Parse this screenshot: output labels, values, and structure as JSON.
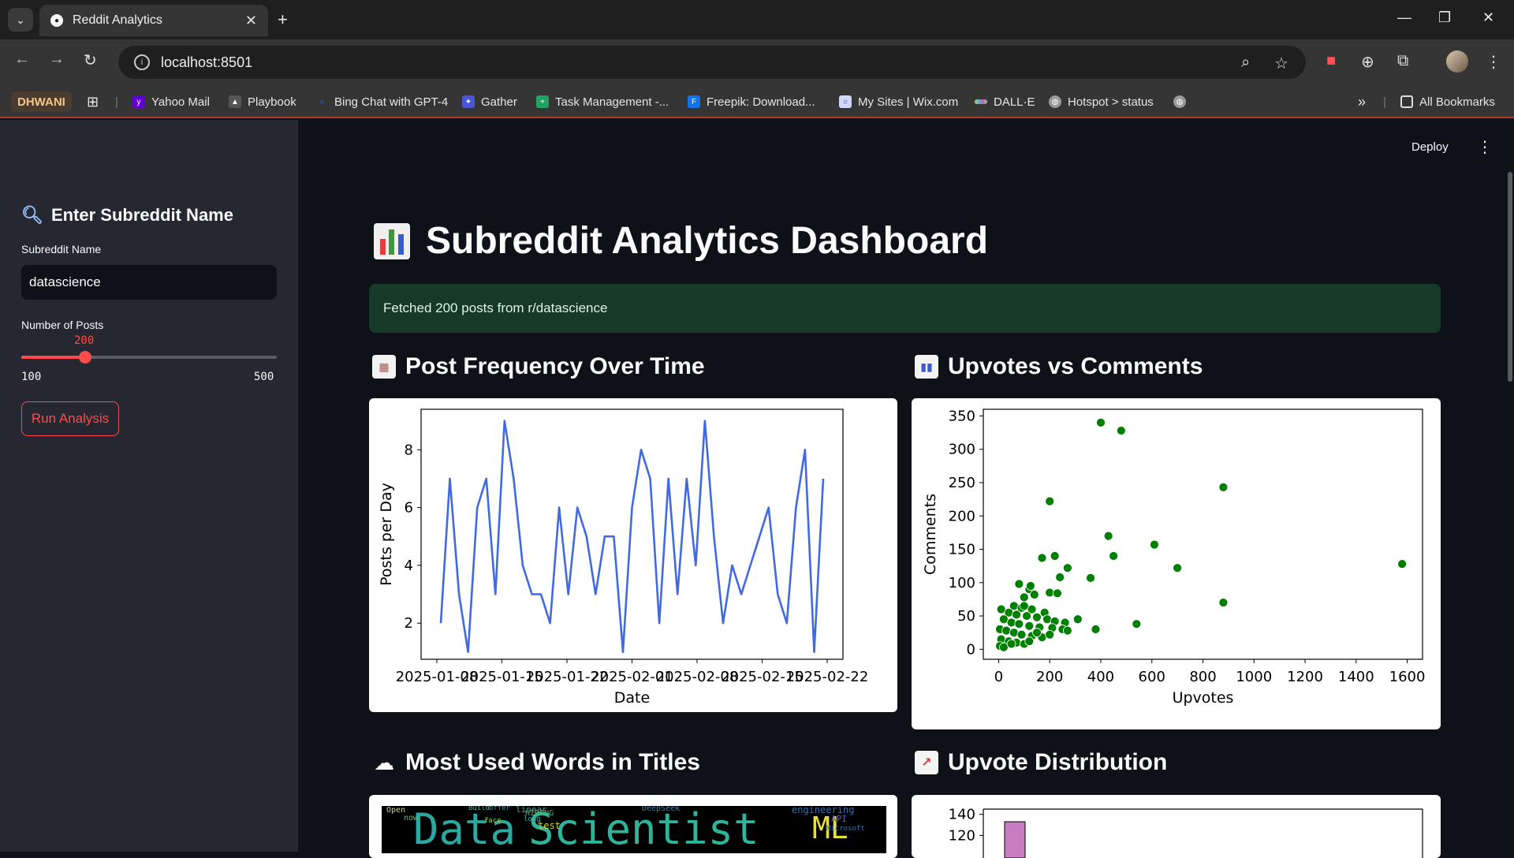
{
  "browser": {
    "tab_title": "Reddit Analytics",
    "url": "localhost:8501",
    "bookmarks": [
      {
        "label": "Yahoo Mail",
        "icon": "yahoo-icon",
        "color": "#6001d2"
      },
      {
        "label": "Playbook",
        "icon": "playbook-icon",
        "color": "#555555"
      },
      {
        "label": "Bing Chat with GPT-4",
        "icon": "bing-search-icon",
        "color": "#2b6de8"
      },
      {
        "label": "Gather",
        "icon": "gather-icon",
        "color": "#4b55d6"
      },
      {
        "label": "Task Management -...",
        "icon": "task-sheet-icon",
        "color": "#1ea362"
      },
      {
        "label": "Freepik: Download...",
        "icon": "freepik-icon",
        "color": "#1273eb"
      },
      {
        "label": "My Sites | Wix.com",
        "icon": "wix-icon",
        "color": "#d0d8ff"
      },
      {
        "label": "DALL·E",
        "icon": "dalle-icon",
        "color": "#e8c547"
      },
      {
        "label": "Hotspot > status",
        "icon": "globe-icon",
        "color": "#9a9a9a"
      }
    ],
    "profile_chip": "DHWANI",
    "all_bookmarks": "All Bookmarks"
  },
  "sidebar": {
    "header": "Enter Subreddit Name",
    "subreddit_label": "Subreddit Name",
    "subreddit_value": "datascience",
    "posts_label": "Number of Posts",
    "slider": {
      "value": 200,
      "min": 100,
      "max": 500,
      "value_text": "200",
      "min_text": "100",
      "max_text": "500"
    },
    "run_button": "Run Analysis"
  },
  "header": {
    "deploy": "Deploy"
  },
  "main": {
    "title": "Subreddit Analytics Dashboard",
    "success_message": "Fetched 200 posts from r/datascience",
    "sections": {
      "post_frequency": "Post Frequency Over Time",
      "upvotes_vs_comments": "Upvotes vs Comments",
      "word_cloud": "Most Used Words in Titles",
      "upvote_distribution": "Upvote Distribution"
    }
  },
  "colors": {
    "accent": "#ff4b4b",
    "line": "#4169e1",
    "scatter": "#008000",
    "hist": "#c77dbf"
  },
  "chart_data": [
    {
      "type": "line",
      "xlabel": "Date",
      "ylabel": "Posts per Day",
      "ylim": [
        0.75,
        9.4
      ],
      "yticks": [
        2,
        4,
        6,
        8
      ],
      "xticks": [
        "2025-01-08",
        "2025-01-15",
        "2025-01-22",
        "2025-02-01",
        "2025-02-08",
        "2025-02-15",
        "2025-02-22"
      ],
      "series": [
        {
          "values": [
            2,
            7,
            3,
            1,
            6,
            7,
            3,
            9,
            7,
            4,
            3,
            3,
            2,
            6,
            3,
            6,
            5,
            3,
            5,
            5,
            1,
            6,
            8,
            7,
            2,
            7,
            3,
            7,
            4,
            9,
            5,
            2,
            4,
            3,
            4,
            5,
            6,
            3,
            2,
            6,
            8,
            1,
            7
          ]
        }
      ]
    },
    {
      "type": "scatter",
      "xlabel": "Upvotes",
      "ylabel": "Comments",
      "xlim": [
        -60,
        1660
      ],
      "ylim": [
        -15,
        360
      ],
      "xticks": [
        0,
        200,
        400,
        600,
        800,
        1000,
        1200,
        1400,
        1600
      ],
      "yticks": [
        0,
        50,
        100,
        150,
        200,
        250,
        300,
        350
      ],
      "points": [
        [
          400,
          340
        ],
        [
          480,
          328
        ],
        [
          880,
          243
        ],
        [
          200,
          222
        ],
        [
          430,
          170
        ],
        [
          610,
          157
        ],
        [
          450,
          140
        ],
        [
          220,
          140
        ],
        [
          170,
          137
        ],
        [
          270,
          122
        ],
        [
          700,
          122
        ],
        [
          240,
          108
        ],
        [
          360,
          107
        ],
        [
          80,
          98
        ],
        [
          120,
          90
        ],
        [
          200,
          85
        ],
        [
          230,
          84
        ],
        [
          140,
          82
        ],
        [
          100,
          78
        ],
        [
          880,
          70
        ],
        [
          60,
          65
        ],
        [
          90,
          62
        ],
        [
          130,
          60
        ],
        [
          180,
          55
        ],
        [
          10,
          60
        ],
        [
          40,
          55
        ],
        [
          70,
          52
        ],
        [
          110,
          50
        ],
        [
          150,
          48
        ],
        [
          190,
          45
        ],
        [
          220,
          42
        ],
        [
          260,
          40
        ],
        [
          310,
          45
        ],
        [
          20,
          45
        ],
        [
          50,
          40
        ],
        [
          80,
          38
        ],
        [
          120,
          35
        ],
        [
          160,
          33
        ],
        [
          210,
          32
        ],
        [
          250,
          30
        ],
        [
          270,
          28
        ],
        [
          380,
          30
        ],
        [
          540,
          38
        ],
        [
          1580,
          128
        ],
        [
          5,
          30
        ],
        [
          30,
          28
        ],
        [
          60,
          25
        ],
        [
          90,
          22
        ],
        [
          130,
          20
        ],
        [
          170,
          18
        ],
        [
          10,
          15
        ],
        [
          40,
          12
        ],
        [
          70,
          10
        ],
        [
          100,
          8
        ],
        [
          5,
          5
        ],
        [
          20,
          3
        ],
        [
          50,
          8
        ],
        [
          120,
          12
        ],
        [
          150,
          25
        ],
        [
          200,
          22
        ],
        [
          100,
          65
        ],
        [
          125,
          95
        ]
      ]
    },
    {
      "type": "bar",
      "title": "",
      "ylim": [
        0,
        145
      ],
      "yticks": [
        120,
        140
      ],
      "values": [
        133
      ]
    }
  ],
  "word_cloud": {
    "words": [
      {
        "text": "Data",
        "color": "#2ba9a0",
        "size": 54
      },
      {
        "text": "Scientist",
        "color": "#2fb39a",
        "size": 54
      },
      {
        "text": "ML",
        "color": "#e6e03a",
        "size": 38
      },
      {
        "text": "test",
        "color": "#c9d23a",
        "size": 12
      },
      {
        "text": "HIRING",
        "color": "#5fae5a",
        "size": 10
      },
      {
        "text": "linear",
        "color": "#4e9a9a",
        "size": 11
      },
      {
        "text": "DeepSeek",
        "color": "#3f7fae",
        "size": 10
      },
      {
        "text": "engineering",
        "color": "#3a6ea8",
        "size": 12
      },
      {
        "text": "API",
        "color": "#6e5aa8",
        "size": 11
      },
      {
        "text": "Open",
        "color": "#cfd95a",
        "size": 10
      },
      {
        "text": "Build",
        "color": "#5aa88c",
        "size": 9
      },
      {
        "text": "offer",
        "color": "#4e8fa8",
        "size": 9
      },
      {
        "text": "now",
        "color": "#6ec06e",
        "size": 10
      },
      {
        "text": "face",
        "color": "#9ad24a",
        "size": 9
      },
      {
        "text": "long",
        "color": "#4aa8a8",
        "size": 9
      },
      {
        "text": "Microsoft",
        "color": "#3a6ea8",
        "size": 9
      }
    ]
  }
}
